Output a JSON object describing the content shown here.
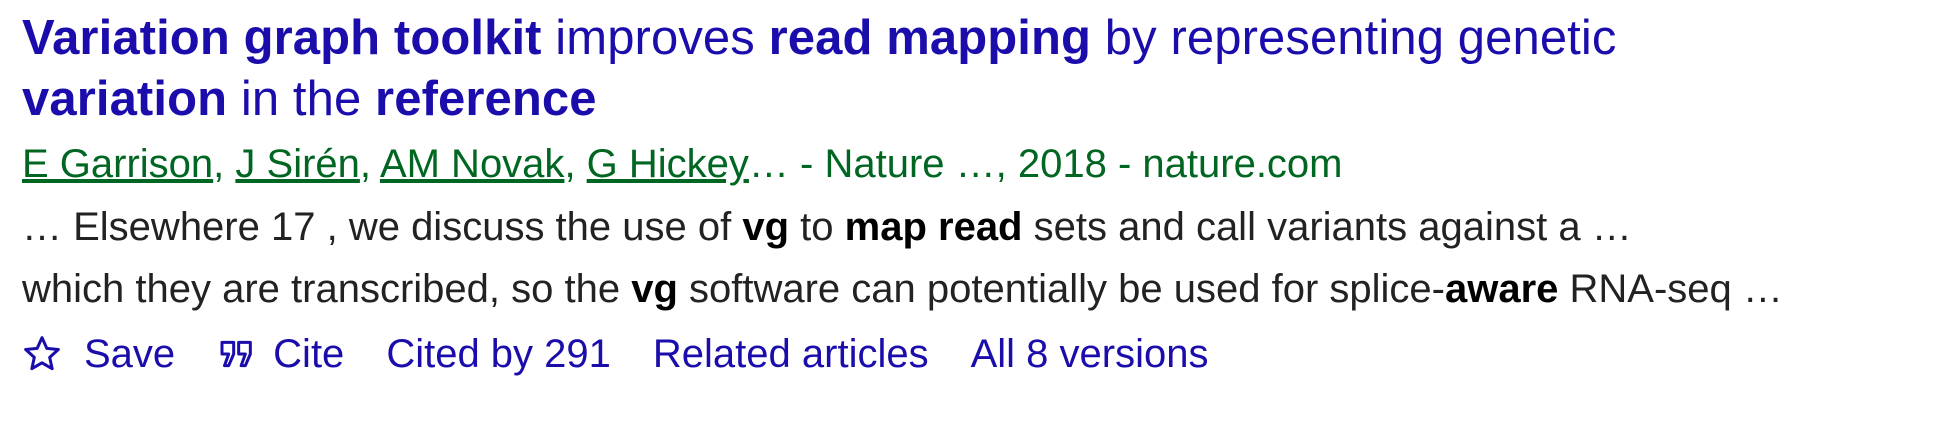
{
  "result": {
    "title_parts": [
      {
        "text": "Variation graph toolkit",
        "bold": true
      },
      {
        "text": " improves ",
        "bold": false
      },
      {
        "text": "read mapping",
        "bold": true
      },
      {
        "text": " by representing genetic ",
        "bold": false
      },
      {
        "text": "variation",
        "bold": true
      },
      {
        "text": " in the ",
        "bold": false
      },
      {
        "text": "reference",
        "bold": true
      }
    ],
    "authors": [
      "E Garrison",
      "J Sirén",
      "AM Novak",
      "G Hickey"
    ],
    "author_sep": ", ",
    "source": "… - Nature …, 2018 - nature.com",
    "snippet_line1": [
      {
        "text": "… Elsewhere 17 , we discuss the use of ",
        "bold": false
      },
      {
        "text": "vg",
        "bold": true
      },
      {
        "text": " to ",
        "bold": false
      },
      {
        "text": "map read",
        "bold": true
      },
      {
        "text": " sets and call variants against a …",
        "bold": false
      }
    ],
    "snippet_line2": [
      {
        "text": "which they are transcribed, so the ",
        "bold": false
      },
      {
        "text": "vg",
        "bold": true
      },
      {
        "text": " software can potentially be used for splice-",
        "bold": false
      },
      {
        "text": "aware",
        "bold": true
      },
      {
        "text": " RNA-seq …",
        "bold": false
      }
    ],
    "actions": {
      "save": "Save",
      "cite": "Cite",
      "cited_by": "Cited by 291",
      "related": "Related articles",
      "versions": "All 8 versions"
    },
    "icons": {
      "save": "star-outline-icon",
      "cite": "quote-icon"
    },
    "colors": {
      "link": "#1a0dab",
      "green": "#006621",
      "text": "#222222"
    }
  }
}
